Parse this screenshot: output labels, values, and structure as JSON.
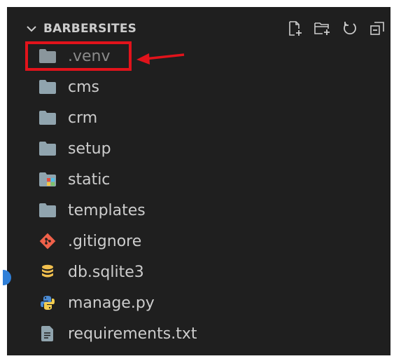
{
  "explorer": {
    "section_title": "BARBERSITES",
    "actions": [
      {
        "name": "new-file-icon"
      },
      {
        "name": "new-folder-icon"
      },
      {
        "name": "refresh-icon"
      },
      {
        "name": "collapse-all-icon"
      }
    ]
  },
  "tree": {
    "items": [
      {
        "label": ".venv",
        "icon": "folder-icon",
        "dimmed": true,
        "highlighted": true
      },
      {
        "label": "cms",
        "icon": "folder-icon"
      },
      {
        "label": "crm",
        "icon": "folder-icon"
      },
      {
        "label": "setup",
        "icon": "folder-icon"
      },
      {
        "label": "static",
        "icon": "static-folder-icon"
      },
      {
        "label": "templates",
        "icon": "folder-icon"
      },
      {
        "label": ".gitignore",
        "icon": "git-icon"
      },
      {
        "label": "db.sqlite3",
        "icon": "database-icon"
      },
      {
        "label": "manage.py",
        "icon": "python-icon"
      },
      {
        "label": "requirements.txt",
        "icon": "text-file-icon"
      }
    ]
  },
  "colors": {
    "panel_bg": "#1f1f1f",
    "text": "#cccccc",
    "folder": "#90a4ae",
    "annotation": "#e1131b"
  }
}
